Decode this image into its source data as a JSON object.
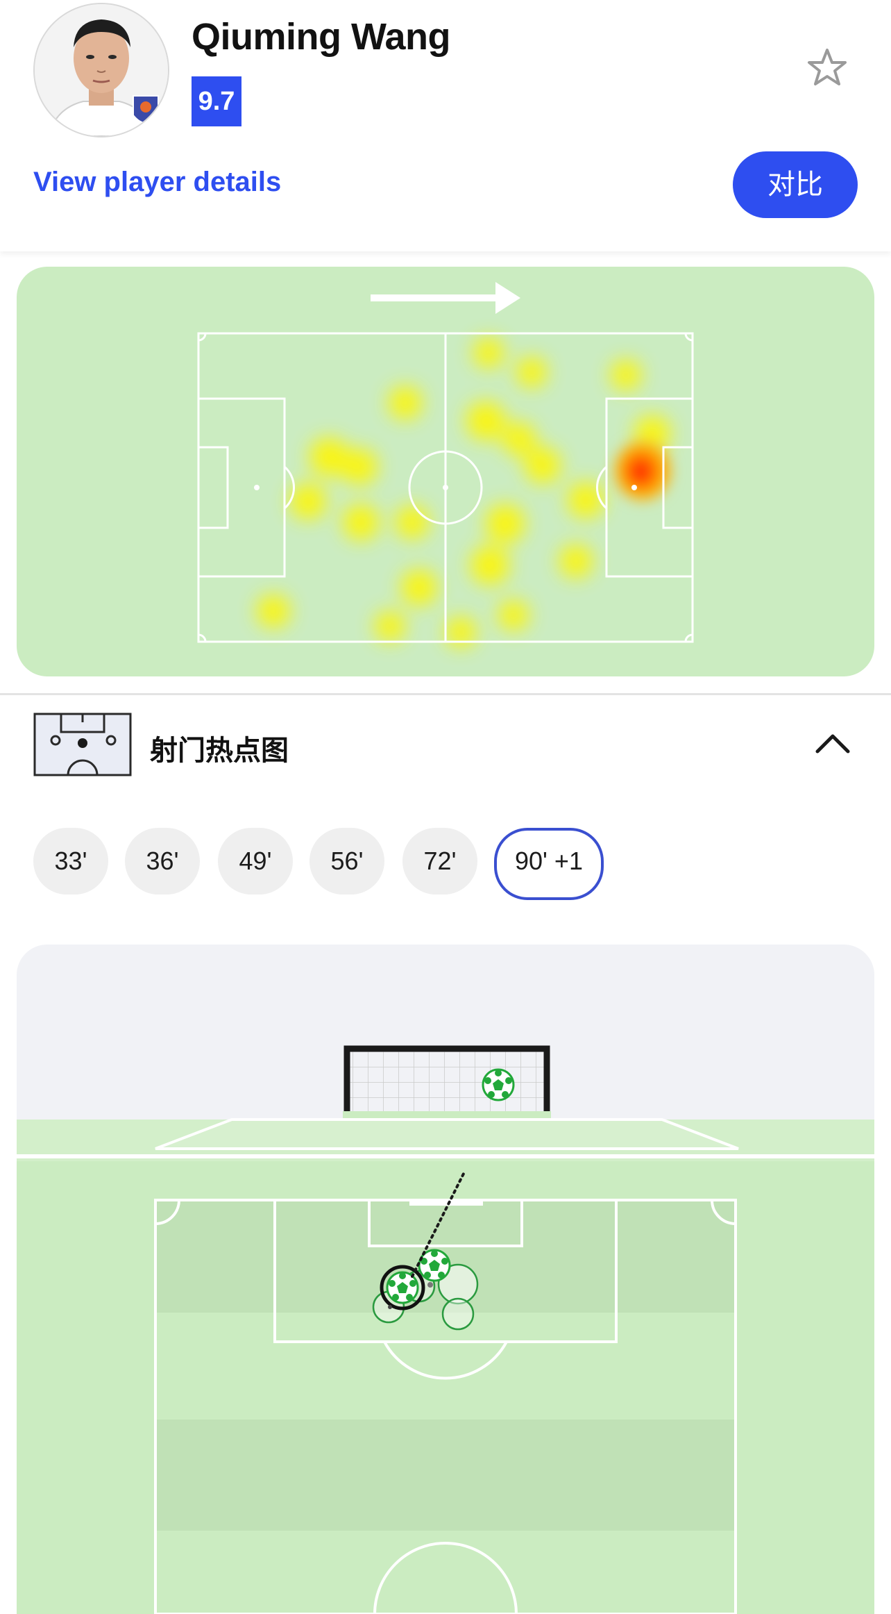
{
  "player": {
    "name": "Qiuming Wang",
    "rating": "9.7",
    "details_link": "View player details",
    "compare_label": "对比"
  },
  "icons": {
    "favorite": "star-outline-icon",
    "collapse": "chevron-up-icon",
    "shotmap": "shotmap-pitch-icon"
  },
  "heatmap": {
    "direction": "attacking-right",
    "colors": {
      "pitch": "#cbecc1",
      "low": "#fff700",
      "high": "#ff3b00"
    }
  },
  "shotmap": {
    "title": "射门热点图",
    "chips": [
      {
        "label": "33'",
        "selected": false
      },
      {
        "label": "36'",
        "selected": false
      },
      {
        "label": "49'",
        "selected": false
      },
      {
        "label": "56'",
        "selected": false
      },
      {
        "label": "72'",
        "selected": false
      },
      {
        "label": "90' +1",
        "selected": true
      }
    ],
    "colors": {
      "accent": "#2e4ef0",
      "goal": "#22a83a",
      "pitch": "#cbecc1"
    }
  }
}
